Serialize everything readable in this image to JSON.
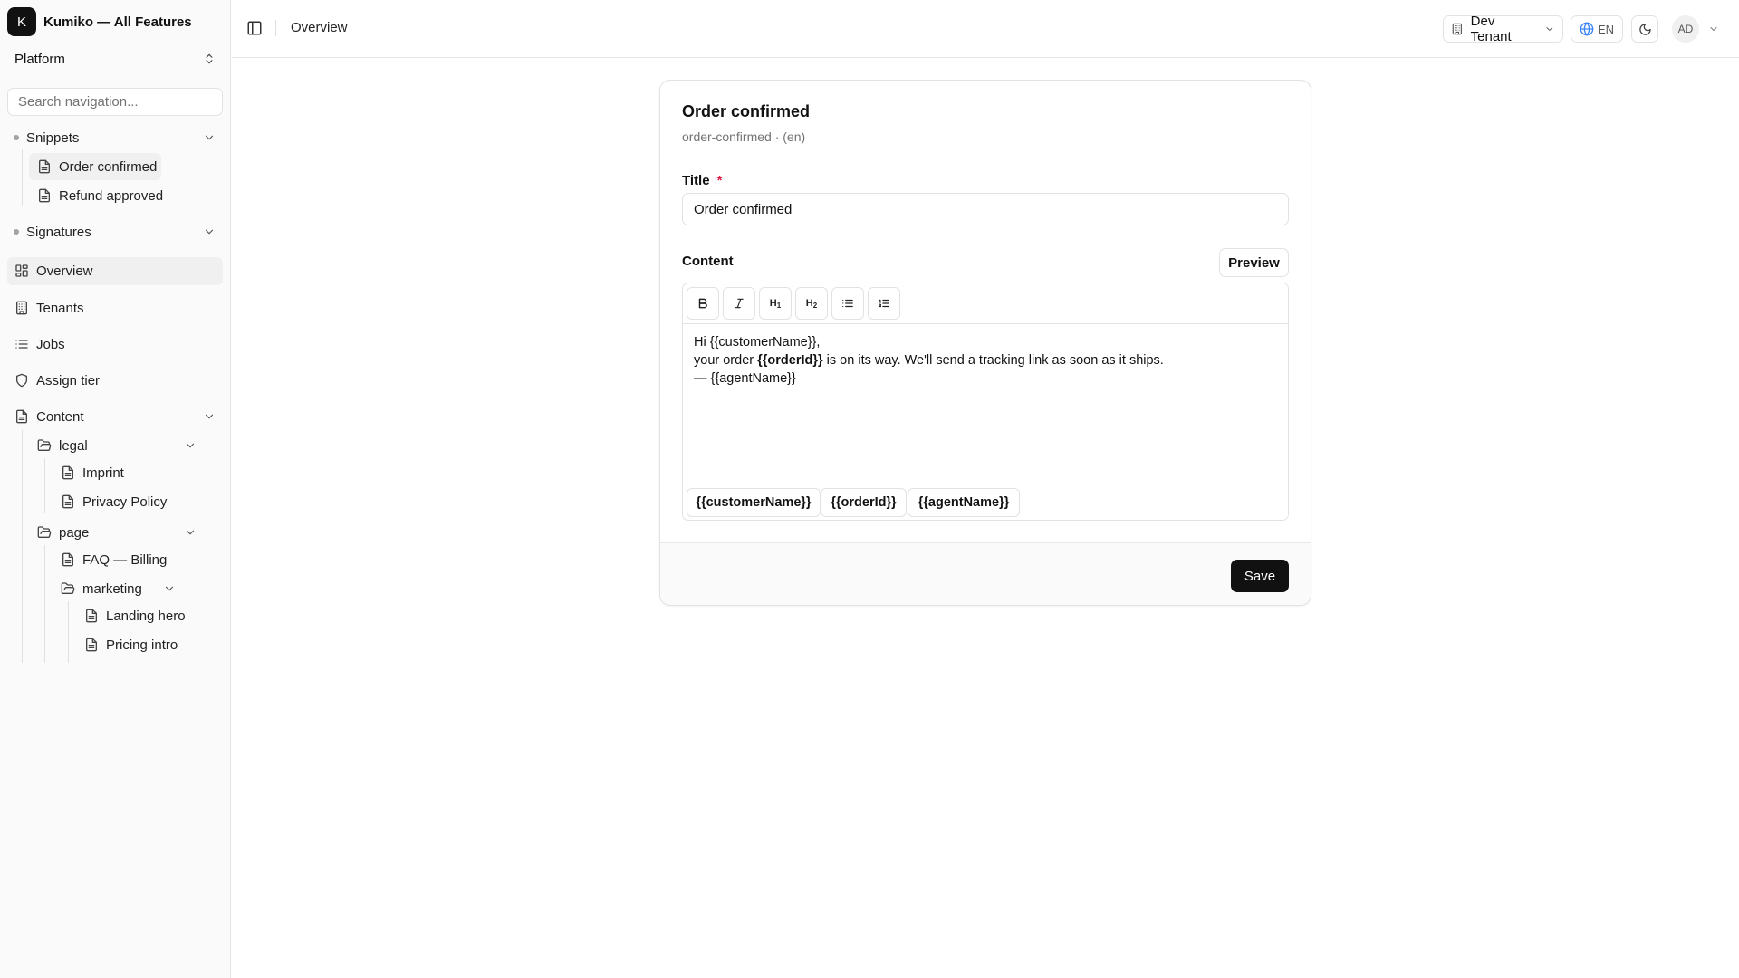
{
  "app": {
    "logo_letter": "K",
    "name": "Kumiko — All Features"
  },
  "sidebar": {
    "switcher_label": "Platform",
    "search_placeholder": "Search navigation...",
    "snippets": {
      "label": "Snippets",
      "items": [
        "Order confirmed",
        "Refund approved"
      ]
    },
    "signatures": {
      "label": "Signatures"
    },
    "nav": [
      {
        "label": "Overview",
        "icon": "layout-grid-icon",
        "active": true
      },
      {
        "label": "Tenants",
        "icon": "building-icon"
      },
      {
        "label": "Jobs",
        "icon": "list-icon"
      },
      {
        "label": "Assign tier",
        "icon": "shield-icon"
      }
    ],
    "content": {
      "label": "Content",
      "legal": {
        "label": "legal",
        "items": [
          "Imprint",
          "Privacy Policy"
        ]
      },
      "page": {
        "label": "page",
        "items": [
          "FAQ — Billing"
        ],
        "marketing": {
          "label": "marketing",
          "items": [
            "Landing hero",
            "Pricing intro"
          ]
        }
      }
    }
  },
  "topbar": {
    "breadcrumb": "Overview",
    "tenant_label": "Dev Tenant",
    "language_label": "EN",
    "user_initials": "AD"
  },
  "card": {
    "title": "Order confirmed",
    "subtitle": "order-confirmed · (en)",
    "title_field": {
      "label": "Title",
      "required_mark": "*",
      "value": "Order confirmed"
    },
    "content_field": {
      "label": "Content",
      "preview_label": "Preview",
      "toolbar": {
        "bold_icon": "bold-icon",
        "italic_icon": "italic-icon",
        "heading1_main": "H",
        "heading1_sub": "1",
        "heading2_main": "H",
        "heading2_sub": "2",
        "bullet_list_icon": "bullet-list-icon",
        "ordered_list_icon": "ordered-list-icon"
      },
      "body": {
        "line1": "Hi {{customerName}},",
        "line2_prefix": "your order ",
        "line2_bold": "{{orderId}}",
        "line2_suffix": " is on its way. We'll send a tracking link as soon as it ships.",
        "line3": "— {{agentName}}"
      },
      "placeholders": [
        "{{customerName}}",
        "{{orderId}}",
        "{{agentName}}"
      ]
    },
    "save_label": "Save"
  },
  "colors": {
    "accent": "#111111",
    "required": "#e11d48",
    "muted_text": "#737373",
    "border": "#e2e2e2"
  }
}
